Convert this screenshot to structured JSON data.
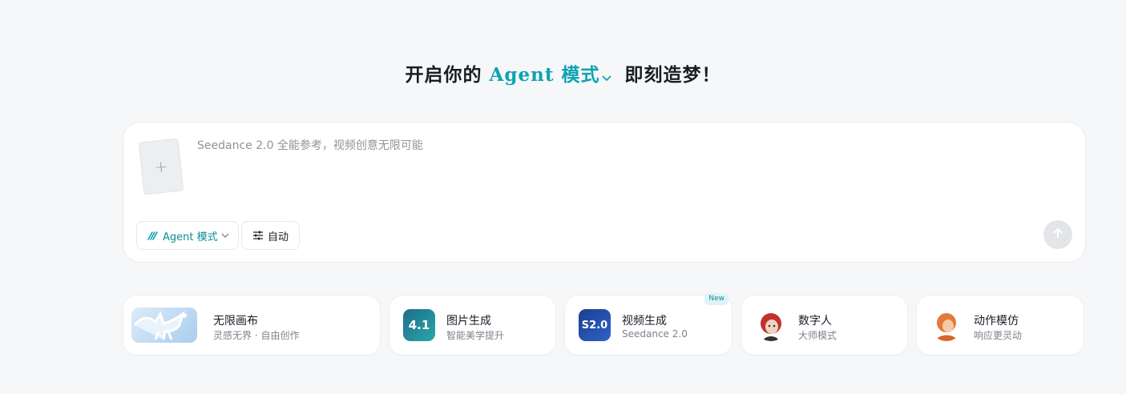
{
  "headline": {
    "prefix": "开启你的",
    "mode": "Agent 模式",
    "suffix": "即刻造梦！"
  },
  "composer": {
    "placeholder": "Seedance 2.0 全能参考，视频创意无限可能",
    "upload_glyph": "+",
    "mode_label": "Agent 模式",
    "auto_label": "自动",
    "colors": {
      "accent": "#0fa3b1",
      "send_disabled": "#e3e5e8"
    }
  },
  "cards": [
    {
      "title": "无限画布",
      "subtitle": "灵感无界 · 自由创作",
      "icon": "pegasus-thumbnail"
    },
    {
      "title": "图片生成",
      "subtitle": "智能美学提升",
      "icon": "image-gen-4.1-icon",
      "icon_text": "4.1"
    },
    {
      "title": "视频生成",
      "subtitle": "Seedance 2.0",
      "icon": "video-gen-s2.0-icon",
      "icon_text": "S2.0",
      "badge": "New"
    },
    {
      "title": "数字人",
      "subtitle": "大师模式",
      "icon": "digital-human-avatar"
    },
    {
      "title": "动作模仿",
      "subtitle": "响应更灵动",
      "icon": "motion-mimic-avatar"
    }
  ]
}
